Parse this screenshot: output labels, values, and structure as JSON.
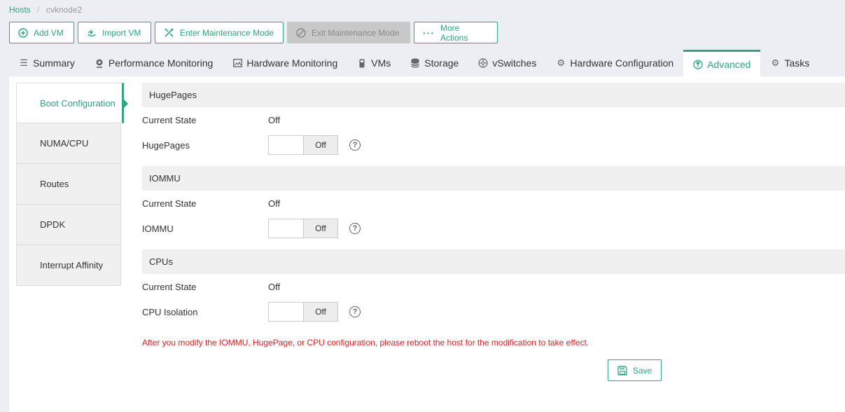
{
  "breadcrumb": {
    "root": "Hosts",
    "separator": "/",
    "current": "cvknode2"
  },
  "toolbar": {
    "add_vm": "Add VM",
    "import_vm": "Import VM",
    "enter_maintenance": "Enter Maintenance Mode",
    "exit_maintenance": "Exit Maintenance Mode",
    "more_actions": "More Actions"
  },
  "tabs": [
    {
      "label": "Summary",
      "icon": "list-icon"
    },
    {
      "label": "Performance Monitoring",
      "icon": "webcam-icon"
    },
    {
      "label": "Hardware Monitoring",
      "icon": "image-icon"
    },
    {
      "label": "VMs",
      "icon": "device-icon"
    },
    {
      "label": "Storage",
      "icon": "database-icon"
    },
    {
      "label": "vSwitches",
      "icon": "network-icon"
    },
    {
      "label": "Hardware Configuration",
      "icon": "gear-icon"
    },
    {
      "label": "Advanced",
      "icon": "upload-circle-icon",
      "active": true
    },
    {
      "label": "Tasks",
      "icon": "cog-icon"
    }
  ],
  "sidenav": [
    "Boot Configuration",
    "NUMA/CPU",
    "Routes",
    "DPDK",
    "Interrupt Affinity"
  ],
  "sections": {
    "hugepages": {
      "title": "HugePages",
      "state_label": "Current State",
      "state_value": "Off",
      "toggle_label": "HugePages",
      "toggle_value": "Off"
    },
    "iommu": {
      "title": "IOMMU",
      "state_label": "Current State",
      "state_value": "Off",
      "toggle_label": "IOMMU",
      "toggle_value": "Off"
    },
    "cpus": {
      "title": "CPUs",
      "state_label": "Current State",
      "state_value": "Off",
      "toggle_label": "CPU Isolation",
      "toggle_value": "Off"
    }
  },
  "help_glyph": "?",
  "warning": "After you modify the IOMMU, HugePage, or CPU configuration, please reboot the host for the modification to take effect.",
  "save_label": "Save",
  "colors": {
    "accent": "#2fa67c",
    "warning": "#e02020",
    "disabled": "#c8c8c8"
  }
}
